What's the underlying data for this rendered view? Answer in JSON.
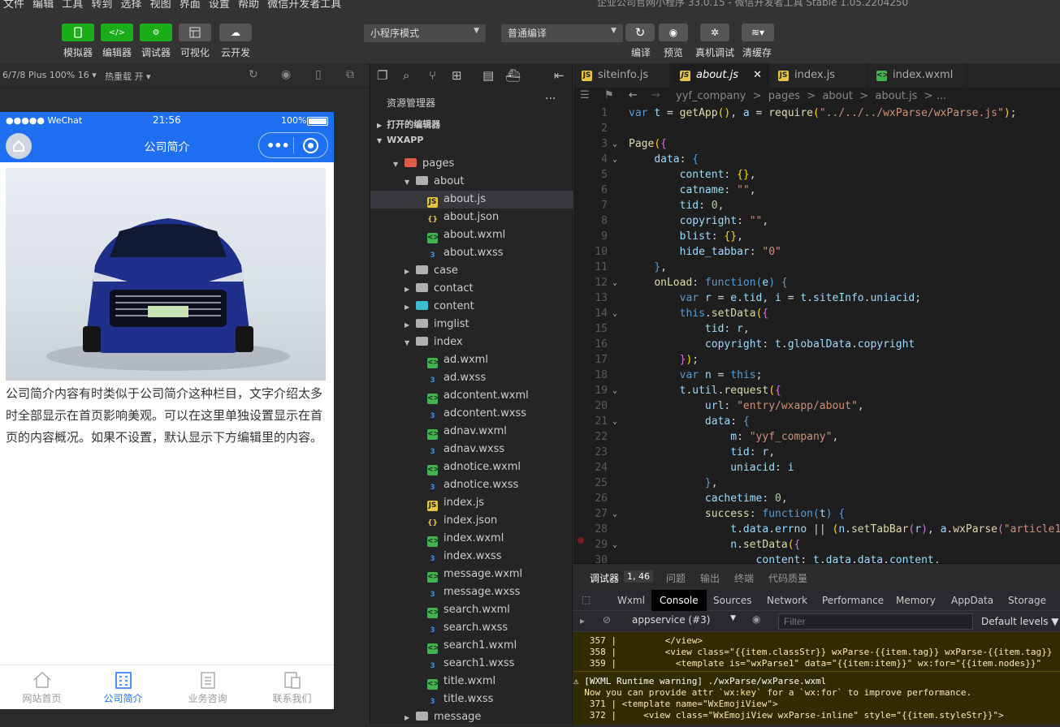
{
  "menubar": {
    "items": "文件 编辑 工具 转到 选择 视图 界面 设置 帮助 微信开发者工具",
    "title": "企业公司官网小程序 33.0.15 - 微信开发者工具 Stable 1.05.2204250"
  },
  "toolbar": {
    "left": [
      {
        "label": "模拟器",
        "icon": "phone-icon"
      },
      {
        "label": "编辑器",
        "icon": "code-icon"
      },
      {
        "label": "调试器",
        "icon": "debug-icon"
      },
      {
        "label": "可视化",
        "icon": "layout-icon"
      },
      {
        "label": "云开发",
        "icon": "cloud-icon"
      }
    ],
    "mode_select": "小程序模式",
    "compile_select": "普通编译",
    "right": [
      {
        "label": "编译",
        "icon": "refresh-icon"
      },
      {
        "label": "预览",
        "icon": "eye-icon"
      },
      {
        "label": "真机调试",
        "icon": "bug-icon"
      },
      {
        "label": "清缓存",
        "icon": "layers-icon"
      }
    ]
  },
  "simulator": {
    "device": "6/7/8 Plus 100% 16 ▾",
    "hotreload": "热重载 开 ▾",
    "status": {
      "carrier": "●●●●● WeChat",
      "time": "21:56",
      "battery": "100%"
    },
    "nav_title": "公司简介",
    "description": "公司简介内容有时类似于公司简介这种栏目，文字介绍太多时全部显示在首页影响美观。可以在这里单独设置显示在首页的内容概况。如果不设置，默认显示下方编辑里的内容。",
    "tabs": [
      {
        "label": "网站首页",
        "active": false
      },
      {
        "label": "公司简介",
        "active": true
      },
      {
        "label": "业务咨询",
        "active": false
      },
      {
        "label": "联系我们",
        "active": false
      }
    ]
  },
  "explorer": {
    "title": "资源管理器",
    "open_editors": "打开的编辑器",
    "root": "WXAPP",
    "tree": [
      {
        "name": "pages",
        "type": "folder-red",
        "depth": 0,
        "open": true
      },
      {
        "name": "about",
        "type": "folder",
        "depth": 1,
        "open": true
      },
      {
        "name": "about.js",
        "type": "js",
        "depth": 2,
        "selected": true
      },
      {
        "name": "about.json",
        "type": "json",
        "depth": 2
      },
      {
        "name": "about.wxml",
        "type": "wxml",
        "depth": 2
      },
      {
        "name": "about.wxss",
        "type": "wxss",
        "depth": 2
      },
      {
        "name": "case",
        "type": "folder",
        "depth": 1,
        "open": false
      },
      {
        "name": "contact",
        "type": "folder",
        "depth": 1,
        "open": false
      },
      {
        "name": "content",
        "type": "folder-cyan",
        "depth": 1,
        "open": false
      },
      {
        "name": "imglist",
        "type": "folder",
        "depth": 1,
        "open": false
      },
      {
        "name": "index",
        "type": "folder",
        "depth": 1,
        "open": true
      },
      {
        "name": "ad.wxml",
        "type": "wxml",
        "depth": 2
      },
      {
        "name": "ad.wxss",
        "type": "wxss",
        "depth": 2
      },
      {
        "name": "adcontent.wxml",
        "type": "wxml",
        "depth": 2
      },
      {
        "name": "adcontent.wxss",
        "type": "wxss",
        "depth": 2
      },
      {
        "name": "adnav.wxml",
        "type": "wxml",
        "depth": 2
      },
      {
        "name": "adnav.wxss",
        "type": "wxss",
        "depth": 2
      },
      {
        "name": "adnotice.wxml",
        "type": "wxml",
        "depth": 2
      },
      {
        "name": "adnotice.wxss",
        "type": "wxss",
        "depth": 2
      },
      {
        "name": "index.js",
        "type": "js",
        "depth": 2
      },
      {
        "name": "index.json",
        "type": "json",
        "depth": 2
      },
      {
        "name": "index.wxml",
        "type": "wxml",
        "depth": 2
      },
      {
        "name": "index.wxss",
        "type": "wxss",
        "depth": 2
      },
      {
        "name": "message.wxml",
        "type": "wxml",
        "depth": 2
      },
      {
        "name": "message.wxss",
        "type": "wxss",
        "depth": 2
      },
      {
        "name": "search.wxml",
        "type": "wxml",
        "depth": 2
      },
      {
        "name": "search.wxss",
        "type": "wxss",
        "depth": 2
      },
      {
        "name": "search1.wxml",
        "type": "wxml",
        "depth": 2
      },
      {
        "name": "search1.wxss",
        "type": "wxss",
        "depth": 2
      },
      {
        "name": "title.wxml",
        "type": "wxml",
        "depth": 2
      },
      {
        "name": "title.wxss",
        "type": "wxss",
        "depth": 2
      },
      {
        "name": "message",
        "type": "folder",
        "depth": 1,
        "open": false
      }
    ]
  },
  "editor": {
    "tabs": [
      {
        "label": "siteinfo.js",
        "type": "js",
        "active": false
      },
      {
        "label": "about.js",
        "type": "js",
        "active": true
      },
      {
        "label": "index.js",
        "type": "js",
        "active": false
      },
      {
        "label": "index.wxml",
        "type": "wxml",
        "active": false
      }
    ],
    "breadcrumb": "yyf_company  >  pages  >  about  >  about.js  > ...",
    "lines": [
      {
        "n": 1,
        "fold": "",
        "h": "<span class='b'>var</span> <span class='p'>t</span> = <span class='f'>getApp</span><span class='y'>()</span>, <span class='p'>a</span> = <span class='f'>require</span><span class='y'>(</span><span class='s'>\"../../../wxParse/wxParse.js\"</span><span class='y'>)</span>;"
      },
      {
        "n": 2,
        "fold": "",
        "h": ""
      },
      {
        "n": 3,
        "fold": "v",
        "h": "<span class='f'>Page</span><span class='y'>(</span><span class='g'>{</span>"
      },
      {
        "n": 4,
        "fold": "v",
        "h": "    <span class='p'>data</span>: <span class='b'>{</span>"
      },
      {
        "n": 5,
        "fold": "",
        "h": "        <span class='p'>content</span>: <span class='y'>{}</span>,"
      },
      {
        "n": 6,
        "fold": "",
        "h": "        <span class='p'>catname</span>: <span class='s'>\"\"</span>,"
      },
      {
        "n": 7,
        "fold": "",
        "h": "        <span class='p'>tid</span>: <span class='n'>0</span>,"
      },
      {
        "n": 8,
        "fold": "",
        "h": "        <span class='p'>copyright</span>: <span class='s'>\"\"</span>,"
      },
      {
        "n": 9,
        "fold": "",
        "h": "        <span class='p'>blist</span>: <span class='y'>{}</span>,"
      },
      {
        "n": 10,
        "fold": "",
        "h": "        <span class='p'>hide_tabbar</span>: <span class='s'>\"0\"</span>"
      },
      {
        "n": 11,
        "fold": "",
        "h": "    <span class='b'>}</span>,"
      },
      {
        "n": 12,
        "fold": "v",
        "h": "    <span class='f'>onLoad</span>: <span class='b'>function</span><span class='b'>(</span><span class='p'>e</span><span class='b'>)</span> <span class='b'>{</span>"
      },
      {
        "n": 13,
        "fold": "",
        "h": "        <span class='b'>var</span> <span class='p'>r</span> = <span class='p'>e</span>.<span class='p'>tid</span>, <span class='p'>i</span> = <span class='p'>t</span>.<span class='p'>siteInfo</span>.<span class='p'>uniacid</span>;"
      },
      {
        "n": 14,
        "fold": "v",
        "h": "        <span class='b'>this</span>.<span class='f'>setData</span><span class='y'>(</span><span class='g'>{</span>"
      },
      {
        "n": 15,
        "fold": "",
        "h": "            <span class='p'>tid</span>: <span class='p'>r</span>,"
      },
      {
        "n": 16,
        "fold": "",
        "h": "            <span class='p'>copyright</span>: <span class='p'>t</span>.<span class='p'>globalData</span>.<span class='p'>copyright</span>"
      },
      {
        "n": 17,
        "fold": "",
        "h": "        <span class='g'>}</span><span class='y'>)</span>;"
      },
      {
        "n": 18,
        "fold": "",
        "h": "        <span class='b'>var</span> <span class='p'>n</span> = <span class='b'>this</span>;"
      },
      {
        "n": 19,
        "fold": "v",
        "h": "        <span class='p'>t</span>.<span class='p'>util</span>.<span class='f'>request</span><span class='y'>(</span><span class='g'>{</span>"
      },
      {
        "n": 20,
        "fold": "",
        "h": "            <span class='p'>url</span>: <span class='s'>\"entry/wxapp/about\"</span>,"
      },
      {
        "n": 21,
        "fold": "v",
        "h": "            <span class='p'>data</span>: <span class='b'>{</span>"
      },
      {
        "n": 22,
        "fold": "",
        "h": "                <span class='p'>m</span>: <span class='s'>\"yyf_company\"</span>,"
      },
      {
        "n": 23,
        "fold": "",
        "h": "                <span class='p'>tid</span>: <span class='p'>r</span>,"
      },
      {
        "n": 24,
        "fold": "",
        "h": "                <span class='p'>uniacid</span>: <span class='p'>i</span>"
      },
      {
        "n": 25,
        "fold": "",
        "h": "            <span class='b'>}</span>,"
      },
      {
        "n": 26,
        "fold": "",
        "h": "            <span class='p'>cachetime</span>: <span class='n'>0</span>,"
      },
      {
        "n": 27,
        "fold": "v",
        "h": "            <span class='f'>success</span>: <span class='b'>function</span><span class='b'>(</span><span class='p'>t</span><span class='b'>)</span> <span class='b'>{</span>"
      },
      {
        "n": 28,
        "fold": "",
        "h": "                <span class='p'>t</span>.<span class='p'>data</span>.<span class='p'>errno</span> || <span class='y'>(</span><span class='p'>n</span>.<span class='f'>setTabBar</span><span class='g'>(</span><span class='p'>r</span><span class='g'>)</span>, <span class='p'>a</span>.<span class='f'>wxParse</span><span class='g'>(</span><span class='s'>\"article1\"</span>"
      },
      {
        "n": 29,
        "fold": "v",
        "h": "                <span class='p'>n</span>.<span class='f'>setData</span><span class='y'>(</span><span class='g'>{</span>"
      },
      {
        "n": 30,
        "fold": "",
        "h": "                    <span class='p'>content</span>: <span class='p'>t</span>.<span class='p'>data</span>.<span class='p'>data</span>.<span class='p'>content</span>,"
      }
    ]
  },
  "debug": {
    "tabs": [
      "调试器",
      "1, 46",
      "问题",
      "输出",
      "终端",
      "代码质量"
    ],
    "devtools": [
      "Wxml",
      "Console",
      "Sources",
      "Network",
      "Performance",
      "Memory",
      "AppData",
      "Storage"
    ],
    "context": "appservice (#3)",
    "filter_placeholder": "Filter",
    "levels": "Default levels ▼",
    "console_lines": [
      "   357 |         </view>",
      "   358 |         <view class=\"{{item.classStr}} wxParse-{{item.tag}} wxParse-{{item.tag}}",
      "   359 |           <template is=\"wxParse1\" data=\"{{item:item}}\" wx:for=\"{{item.nodes}}\"",
      "⚠ [WXML Runtime warning] ./wxParse/wxParse.wxml",
      "  Now you can provide attr `wx:key` for a `wx:for` to improve performance.",
      "   371 | <template name=\"WxEmojiView\">",
      "   372 |     <view class=\"WxEmojiView wxParse-inline\" style=\"{{item.styleStr}}\">"
    ]
  }
}
